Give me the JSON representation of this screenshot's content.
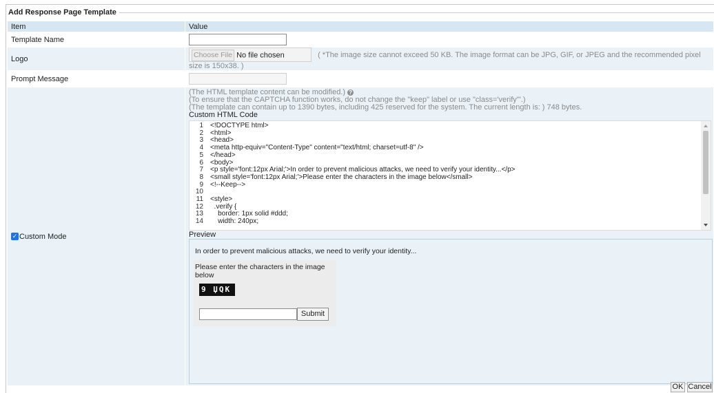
{
  "dialog": {
    "title": "Add Response Page Template",
    "ok_label": "OK",
    "cancel_label": "Cancel"
  },
  "table": {
    "col_item": "Item",
    "col_value": "Value"
  },
  "template_name": {
    "label": "Template Name",
    "value": ""
  },
  "logo": {
    "label": "Logo",
    "choose_file_label": "Choose File",
    "file_status": "No file chosen",
    "hint": "( *The image size cannot exceed 50 KB. The image format can be JPG, GIF, or JPEG and the recommended pixel size is 150x38. )"
  },
  "prompt_message": {
    "label": "Prompt Message",
    "value": ""
  },
  "custom_mode": {
    "label": "Custom Mode",
    "checked": true,
    "note1": "(The HTML template content can be modified.)",
    "note2": "(To ensure that the CAPTCHA function works, do not change the \"keep\" label or use \"class='verify'\".)",
    "note3": "(The template can contain up to 1390 bytes, including 425 reserved for the system. The current length is: ) 748 bytes.",
    "code_label": "Custom HTML Code",
    "preview_label": "Preview"
  },
  "code_lines": [
    {
      "n": "1",
      "t": "<!DOCTYPE html>"
    },
    {
      "n": "2",
      "t": "<html>"
    },
    {
      "n": "3",
      "t": "<head>"
    },
    {
      "n": "4",
      "t": "<meta http-equiv=\"Content-Type\" content=\"text/html; charset=utf-8\" />"
    },
    {
      "n": "5",
      "t": "</head>"
    },
    {
      "n": "6",
      "t": "<body>"
    },
    {
      "n": "7",
      "t": "<p style='font:12px Arial;'>In order to prevent malicious attacks, we need to verify your identity...</p>"
    },
    {
      "n": "8",
      "t": "<small style='font:12px Arial;'>Please enter the characters in the image below</small>"
    },
    {
      "n": "9",
      "t": "<!--Keep-->"
    },
    {
      "n": "10",
      "t": ""
    },
    {
      "n": "11",
      "t": "<style>"
    },
    {
      "n": "12",
      "t": "  .verify {"
    },
    {
      "n": "13",
      "t": "    border: 1px solid #ddd;"
    },
    {
      "n": "14",
      "t": "    width: 240px;"
    }
  ],
  "preview": {
    "message": "In order to prevent malicious attacks, we need to verify your identity...",
    "instruction": "Please enter the characters in the image below",
    "captcha_text": "9 ЏQK",
    "submit_label": "Submit"
  }
}
